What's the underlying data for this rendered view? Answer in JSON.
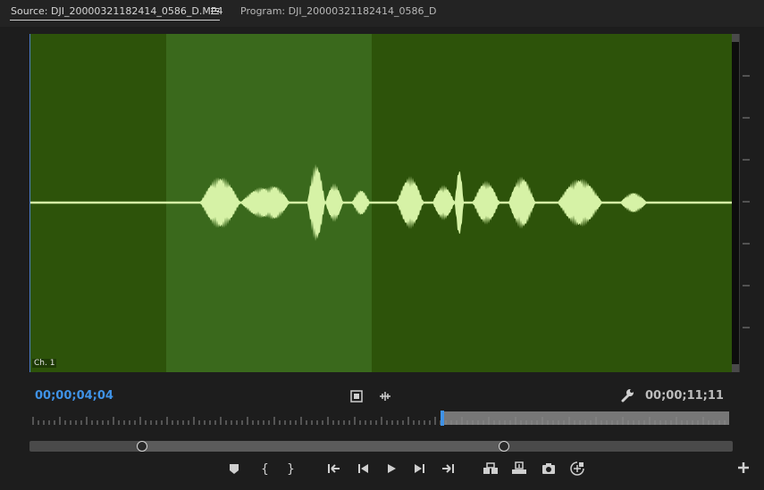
{
  "tabs": {
    "source": "Source: DJI_20000321182414_0586_D.MP4",
    "program": "Program: DJI_20000321182414_0586_D"
  },
  "viewer": {
    "channel_label": "Ch. 1",
    "background_color": "#2d530a",
    "inout_range_color": "#3a691c",
    "waveform_color": "#d6f2a6"
  },
  "timecode": {
    "playhead": "00;00;04;04",
    "duration": "00;00;11;11",
    "playhead_color": "#3f92e6"
  },
  "icons": {
    "panel_menu": "hamburger-menu-icon",
    "drag_video": "film-strip-icon",
    "drag_audio": "audio-waveform-icon",
    "settings": "wrench-icon",
    "add": "plus-icon"
  },
  "transport": [
    {
      "name": "add-marker-button",
      "icon": "marker-icon"
    },
    {
      "name": "mark-in-button",
      "icon": "mark-in-icon"
    },
    {
      "name": "mark-out-button",
      "icon": "mark-out-icon"
    },
    {
      "name": "go-to-in-button",
      "icon": "go-to-in-icon"
    },
    {
      "name": "step-back-button",
      "icon": "step-back-icon"
    },
    {
      "name": "play-button",
      "icon": "play-icon"
    },
    {
      "name": "step-forward-button",
      "icon": "step-forward-icon"
    },
    {
      "name": "go-to-out-button",
      "icon": "go-to-out-icon"
    },
    {
      "name": "insert-button",
      "icon": "insert-icon"
    },
    {
      "name": "overwrite-button",
      "icon": "overwrite-icon"
    },
    {
      "name": "export-frame-button",
      "icon": "camera-icon"
    },
    {
      "name": "button-editor-button",
      "icon": "button-editor-icon"
    }
  ]
}
